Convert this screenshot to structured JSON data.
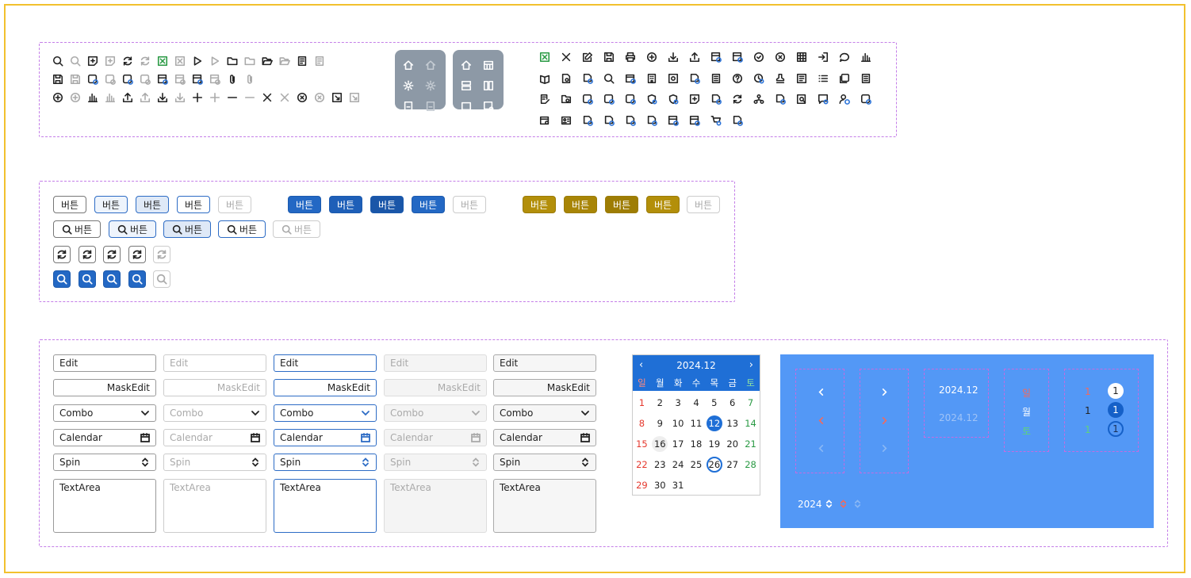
{
  "buttons": {
    "label": "버튼"
  },
  "inputs": {
    "edit": "Edit",
    "maskedit": "MaskEdit",
    "combo": "Combo",
    "calendar": "Calendar",
    "spin": "Spin",
    "textarea": "TextArea"
  },
  "calendar": {
    "title": "2024.12",
    "weekdays": [
      "일",
      "월",
      "화",
      "수",
      "목",
      "금",
      "토"
    ],
    "weeks": [
      [
        "1",
        "2",
        "3",
        "4",
        "5",
        "6",
        "7"
      ],
      [
        "8",
        "9",
        "10",
        "11",
        "12",
        "13",
        "14"
      ],
      [
        "15",
        "16",
        "17",
        "18",
        "19",
        "20",
        "21"
      ],
      [
        "22",
        "23",
        "24",
        "25",
        "26",
        "27",
        "28"
      ],
      [
        "29",
        "30",
        "31",
        "",
        "",
        "",
        ""
      ]
    ],
    "today": "12",
    "selected": "26",
    "hover": "16"
  },
  "blue_panel": {
    "title_normal": "2024.12",
    "title_dim": "2024.12",
    "day_sun": "일",
    "day_mon": "월",
    "day_sat": "토",
    "num_red": "1",
    "num_black": "1",
    "num_green": "1",
    "circle_white": "1",
    "circle_blue": "1",
    "circle_outline": "1",
    "year": "2024"
  },
  "colors": {
    "frame": "#f2c12e",
    "primary": "#2368c4",
    "gold": "#b38f0a",
    "panel": "#5398f6",
    "dashed": "#c47ee8"
  }
}
